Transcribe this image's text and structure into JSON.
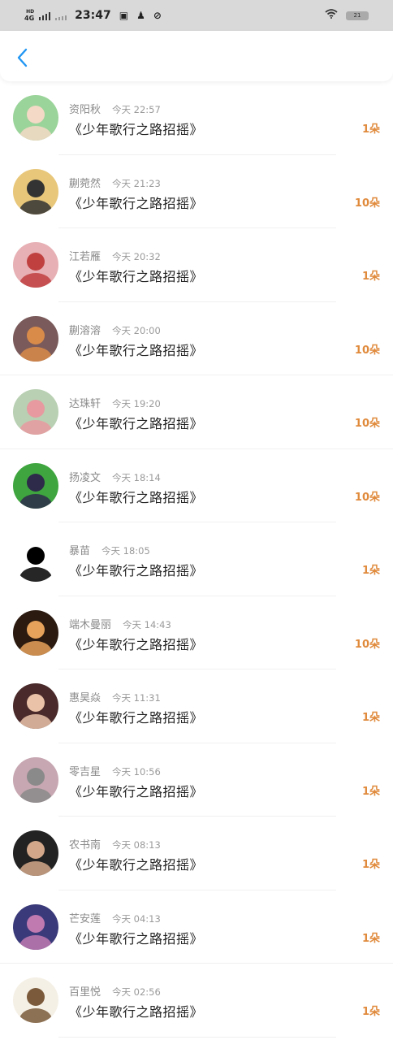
{
  "status_bar": {
    "network": "4G",
    "network_sub": "HD",
    "time": "23:47",
    "battery": "21"
  },
  "header": {
    "back_icon": "chevron-left-icon",
    "accent": "#2196f3"
  },
  "colors": {
    "count": "#e08a3c",
    "name": "#8a8a8a"
  },
  "items": [
    {
      "name": "资阳秋",
      "time": "今天 22:57",
      "gift": "《少年歌行之路招摇》",
      "count": "1朵",
      "avatar_colors": [
        "#9ad49a",
        "#f3d9c6"
      ]
    },
    {
      "name": "蒯菀然",
      "time": "今天 21:23",
      "gift": "《少年歌行之路招摇》",
      "count": "10朵",
      "avatar_colors": [
        "#e8c77a",
        "#333333"
      ]
    },
    {
      "name": "江若雁",
      "time": "今天 20:32",
      "gift": "《少年歌行之路招摇》",
      "count": "1朵",
      "avatar_colors": [
        "#e7b0b4",
        "#c04040"
      ]
    },
    {
      "name": "蒯溶溶",
      "time": "今天 20:00",
      "gift": "《少年歌行之路招摇》",
      "count": "10朵",
      "avatar_colors": [
        "#7a5a5a",
        "#d98b4a"
      ]
    },
    {
      "name": "达珠轩",
      "time": "今天 19:20",
      "gift": "《少年歌行之路招摇》",
      "count": "10朵",
      "avatar_colors": [
        "#b9d0b3",
        "#e79aa0"
      ]
    },
    {
      "name": "扬凌文",
      "time": "今天 18:14",
      "gift": "《少年歌行之路招摇》",
      "count": "10朵",
      "avatar_colors": [
        "#3fa63f",
        "#2d2a4a"
      ]
    },
    {
      "name": "暴苗",
      "time": "今天 18:05",
      "gift": "《少年歌行之路招摇》",
      "count": "1朵",
      "avatar_colors": [
        "#ffffff",
        "#000000"
      ]
    },
    {
      "name": "端木曼丽",
      "time": "今天 14:43",
      "gift": "《少年歌行之路招摇》",
      "count": "10朵",
      "avatar_colors": [
        "#2a1a10",
        "#e6a25a"
      ]
    },
    {
      "name": "惠昊焱",
      "time": "今天 11:31",
      "gift": "《少年歌行之路招摇》",
      "count": "1朵",
      "avatar_colors": [
        "#4a2a2a",
        "#e9c2a8"
      ]
    },
    {
      "name": "零吉星",
      "time": "今天 10:56",
      "gift": "《少年歌行之路招摇》",
      "count": "1朵",
      "avatar_colors": [
        "#c7a7b1",
        "#8a8a8a"
      ]
    },
    {
      "name": "农书南",
      "time": "今天 08:13",
      "gift": "《少年歌行之路招摇》",
      "count": "1朵",
      "avatar_colors": [
        "#222222",
        "#d3a88a"
      ]
    },
    {
      "name": "芒安莲",
      "time": "今天 04:13",
      "gift": "《少年歌行之路招摇》",
      "count": "1朵",
      "avatar_colors": [
        "#3a3a7a",
        "#c07ab0"
      ]
    },
    {
      "name": "百里悦",
      "time": "今天 02:56",
      "gift": "《少年歌行之路招摇》",
      "count": "1朵",
      "avatar_colors": [
        "#f5f0e6",
        "#7a5a3a"
      ]
    }
  ]
}
